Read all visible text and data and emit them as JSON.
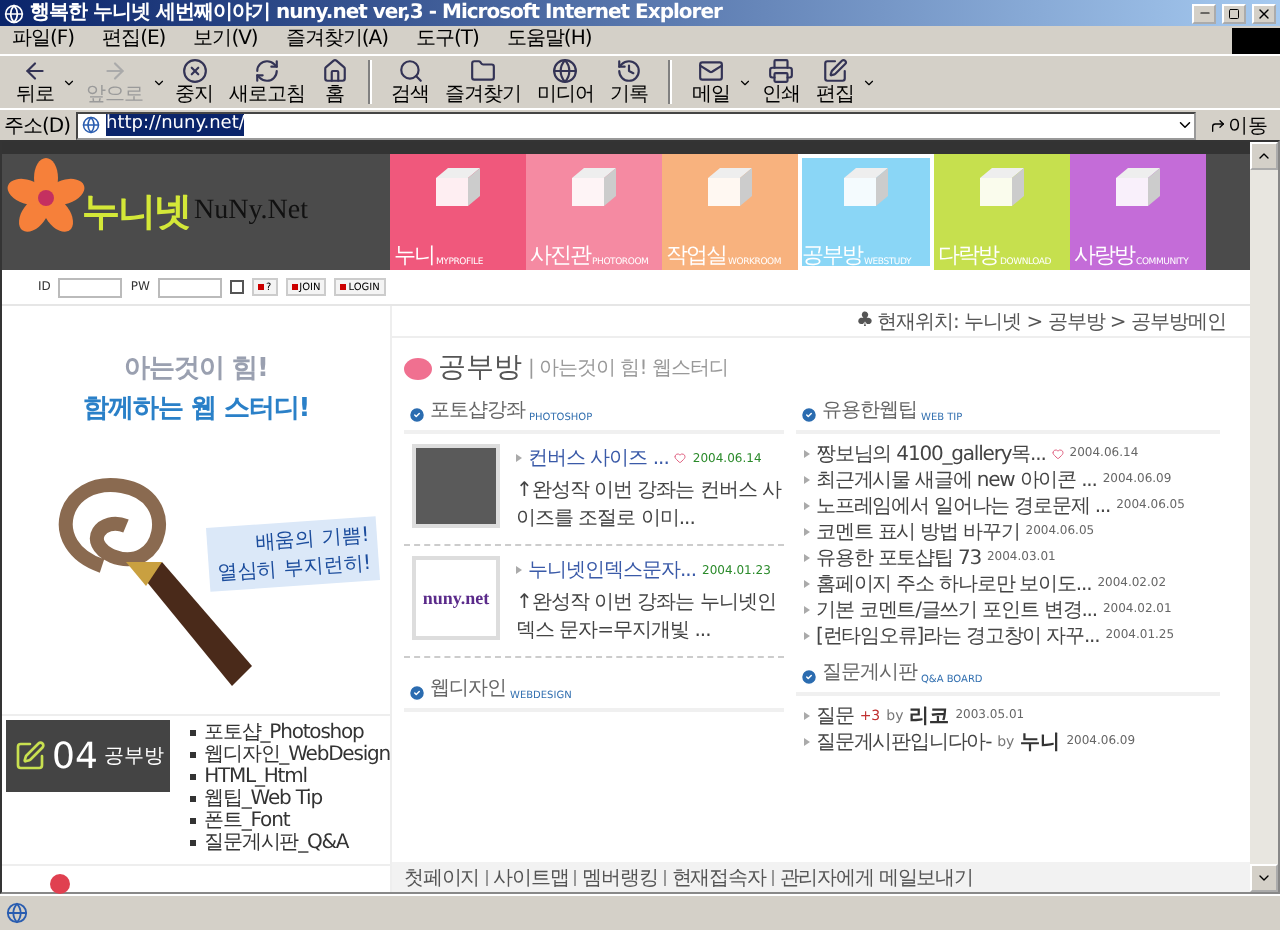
{
  "window": {
    "title": "행복한 누니넷 세번째이야기 nuny.net ver,3 - Microsoft Internet Explorer"
  },
  "menu": [
    "파일(F)",
    "편집(E)",
    "보기(V)",
    "즐겨찾기(A)",
    "도구(T)",
    "도움말(H)"
  ],
  "toolbar": [
    {
      "label": "뒤로",
      "disabled": false,
      "dropdown": true
    },
    {
      "label": "앞으로",
      "disabled": true,
      "dropdown": true
    },
    {
      "label": "중지",
      "disabled": false,
      "dropdown": false
    },
    {
      "label": "새로고침",
      "disabled": false,
      "dropdown": false
    },
    {
      "label": "홈",
      "disabled": false,
      "dropdown": false
    },
    {
      "label": "검색",
      "disabled": false,
      "dropdown": false
    },
    {
      "label": "즐겨찾기",
      "disabled": false,
      "dropdown": false
    },
    {
      "label": "미디어",
      "disabled": false,
      "dropdown": false
    },
    {
      "label": "기록",
      "disabled": false,
      "dropdown": false
    },
    {
      "label": "메일",
      "disabled": false,
      "dropdown": true
    },
    {
      "label": "인쇄",
      "disabled": false,
      "dropdown": false
    },
    {
      "label": "편집",
      "disabled": false,
      "dropdown": true
    }
  ],
  "address": {
    "label": "주소(D)",
    "value": "http://nuny.net/",
    "go": "이동"
  },
  "site": {
    "logo_korean": "누니넷",
    "logo_latin": "NuNy.Net",
    "nav": [
      {
        "label": "누니",
        "sub": "MYPROFILE",
        "color": "#f0587c",
        "selected": false
      },
      {
        "label": "사진관",
        "sub": "PHOTOROOM",
        "color": "#f58aa2",
        "selected": false
      },
      {
        "label": "작업실",
        "sub": "WORKROOM",
        "color": "#f8b27e",
        "selected": false
      },
      {
        "label": "공부방",
        "sub": "WEBSTUDY",
        "color": "#8ad6f6",
        "selected": true
      },
      {
        "label": "다락방",
        "sub": "DOWNLOAD",
        "color": "#c6e04e",
        "selected": false
      },
      {
        "label": "사랑방",
        "sub": "COMMUNITY",
        "color": "#c46cd8",
        "selected": false
      }
    ]
  },
  "login": {
    "id_label": "ID",
    "pw_label": "PW",
    "remember": false,
    "buttons": [
      "?",
      "JOIN",
      "LOGIN"
    ]
  },
  "banner": {
    "line_1": "아는것이 힘!",
    "line_2": "함께하는 웹 스터디!",
    "tagline_1": "배움의 기쁨!",
    "tagline_2": "열심히 부지런히!"
  },
  "section_badge": {
    "number": "04",
    "label": "공부방"
  },
  "sidebar": {
    "items": [
      "포토샵_Photoshop",
      "웹디자인_WebDesign",
      "HTML_Html",
      "웹팁_Web Tip",
      "폰트_Font",
      "질문게시판_Q&A"
    ]
  },
  "breadcrumb": {
    "mark": "♣",
    "text": "현재위치: 누니넷 > 공부방 > 공부방메인"
  },
  "page_title": {
    "title": "공부방",
    "subtitle": "| 아는것이 힘! 웹스터디"
  },
  "photoshop": {
    "title": "포토샵강좌",
    "sub": "PHOTOSHOP",
    "posts": [
      {
        "title": "컨버스 사이즈 ...",
        "new": true,
        "date": "2004.06.14",
        "snippet": "↑완성작 이번 강좌는 컨버스 사이즈를 조절로 이미...",
        "kind": "photo"
      },
      {
        "title": "누니넷인덱스문자...",
        "new": false,
        "date": "2004.01.23",
        "snippet": "↑완성작 이번 강좌는 누니넷인덱스 문자=무지개빛 ...",
        "kind": "logo",
        "thumb_text": "nuny.net"
      }
    ]
  },
  "webdesign": {
    "title": "웹디자인",
    "sub": "WEBDESIGN"
  },
  "webtip": {
    "title": "유용한웹팁",
    "sub": "WEB TIP",
    "items": [
      {
        "title": "짱보님의 4100_gallery목...",
        "new": true,
        "date": "2004.06.14"
      },
      {
        "title": "최근게시물 새글에 new 아이콘 ...",
        "new": false,
        "date": "2004.06.09"
      },
      {
        "title": "노프레임에서 일어나는 경로문제 ...",
        "new": false,
        "date": "2004.06.05"
      },
      {
        "title": "코멘트 표시 방법 바꾸기",
        "new": false,
        "date": "2004.06.05"
      },
      {
        "title": "유용한 포토샵팁 73",
        "new": false,
        "date": "2004.03.01"
      },
      {
        "title": "홈페이지 주소 하나로만 보이도...",
        "new": false,
        "date": "2004.02.02"
      },
      {
        "title": "기본 코멘트/글쓰기 포인트 변경...",
        "new": false,
        "date": "2004.02.01"
      },
      {
        "title": "[런타임오류]라는 경고창이 자꾸...",
        "new": false,
        "date": "2004.01.25"
      }
    ]
  },
  "qna": {
    "title": "질문게시판",
    "sub": "Q&A BOARD",
    "items": [
      {
        "title": "질문",
        "count": "+3",
        "by": "by",
        "author": "리코",
        "date": "2003.05.01"
      },
      {
        "title": "질문게시판입니다아-",
        "by": "by",
        "author": "누니",
        "date": "2004.06.09"
      }
    ]
  },
  "footer_links": [
    "첫페이지",
    "사이트맵",
    "멤버랭킹",
    "현재접속자",
    "관리자에게 메일보내기"
  ]
}
